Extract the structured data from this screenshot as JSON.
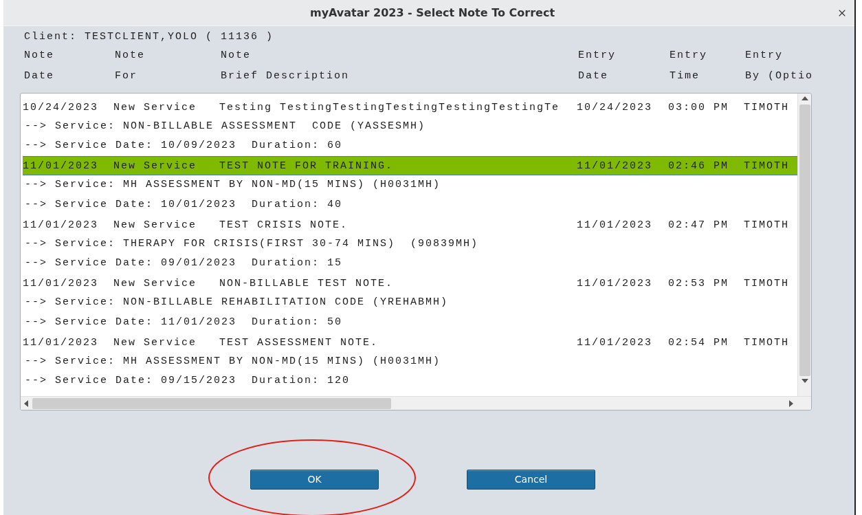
{
  "window": {
    "title": "myAvatar 2023 - Select Note To Correct"
  },
  "client": "Client: TESTCLIENT,YOLO ( 11136 )",
  "columns": [
    {
      "line1": "Note",
      "line2": "Date"
    },
    {
      "line1": "Note",
      "line2": "For"
    },
    {
      "line1": "Note",
      "line2": "Brief Description"
    },
    {
      "line1": "Entry",
      "line2": "Date"
    },
    {
      "line1": "Entry",
      "line2": "Time"
    },
    {
      "line1": "Entry",
      "line2": "By (Optio"
    }
  ],
  "notes": [
    {
      "selected": false,
      "cells": [
        "10/24/2023",
        "New Service",
        "Testing TestingTestingTestingTestingTestingTe",
        "10/24/2023",
        "03:00 PM",
        "TIMOTH"
      ],
      "details": [
        "--> Service: NON-BILLABLE ASSESSMENT  CODE (YASSESMH)",
        "--> Service Date: 10/09/2023  Duration: 60"
      ]
    },
    {
      "selected": true,
      "cells": [
        "11/01/2023",
        "New Service",
        "TEST NOTE FOR TRAINING.",
        "11/01/2023",
        "02:46 PM",
        "TIMOTH"
      ],
      "details": [
        "--> Service: MH ASSESSMENT BY NON-MD(15 MINS) (H0031MH)",
        "--> Service Date: 10/01/2023  Duration: 40"
      ]
    },
    {
      "selected": false,
      "cells": [
        "11/01/2023",
        "New Service",
        "TEST CRISIS NOTE.",
        "11/01/2023",
        "02:47 PM",
        "TIMOTH"
      ],
      "details": [
        "--> Service: THERAPY FOR CRISIS(FIRST 30-74 MINS)  (90839MH)",
        "--> Service Date: 09/01/2023  Duration: 15"
      ]
    },
    {
      "selected": false,
      "cells": [
        "11/01/2023",
        "New Service",
        "NON-BILLABLE TEST NOTE.",
        "11/01/2023",
        "02:53 PM",
        "TIMOTH"
      ],
      "details": [
        "--> Service: NON-BILLABLE REHABILITATION CODE (YREHABMH)",
        "--> Service Date: 11/01/2023  Duration: 50"
      ]
    },
    {
      "selected": false,
      "cells": [
        "11/01/2023",
        "New Service",
        "TEST ASSESSMENT NOTE.",
        "11/01/2023",
        "02:54 PM",
        "TIMOTH"
      ],
      "details": [
        "--> Service: MH ASSESSMENT BY NON-MD(15 MINS) (H0031MH)",
        "--> Service Date: 09/15/2023  Duration: 120"
      ]
    }
  ],
  "buttons": [
    {
      "label": "OK"
    },
    {
      "label": "Cancel"
    }
  ],
  "annotation": {
    "kind": "ellipse"
  }
}
